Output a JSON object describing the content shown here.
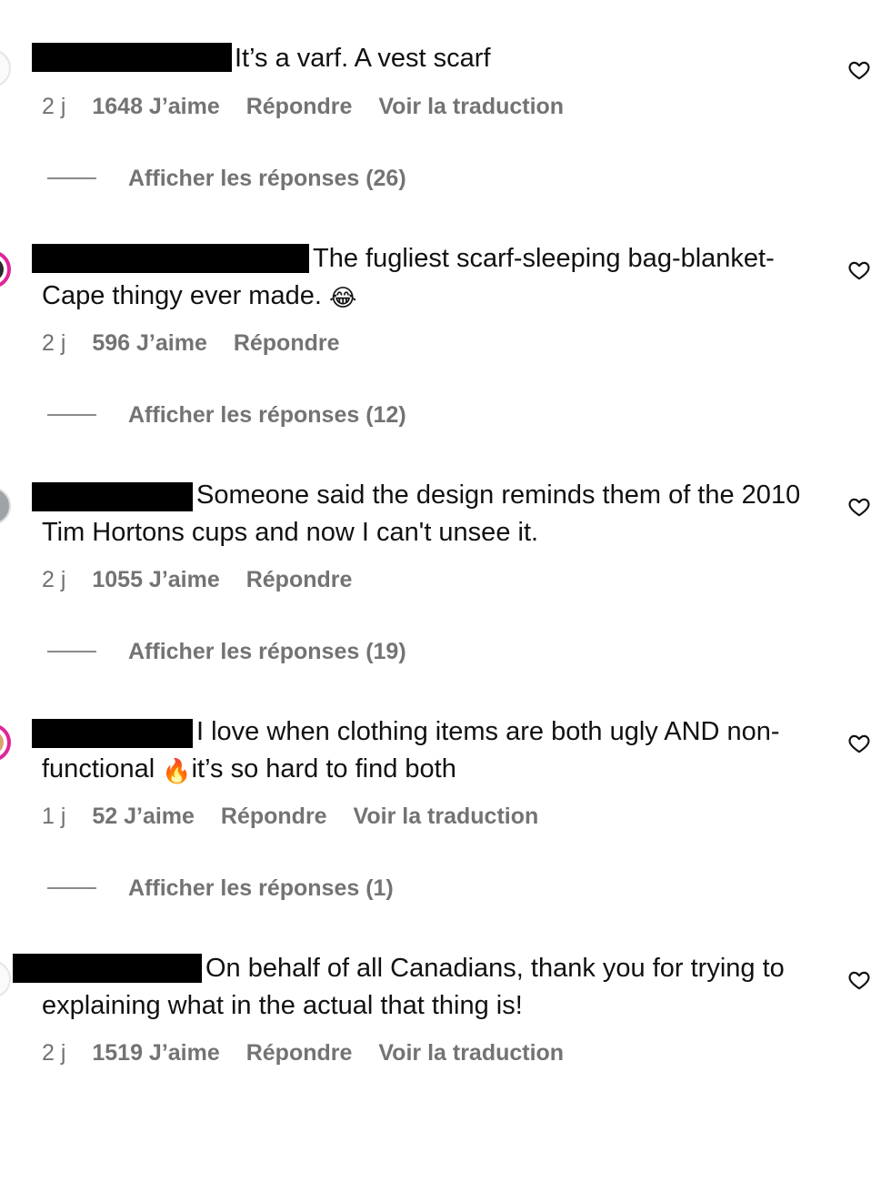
{
  "comments": [
    {
      "text": "It’s a varf. A vest scarf",
      "age": "2 j",
      "likes": "1648 J’aime",
      "reply_label": "Répondre",
      "translate_label": "Voir la traduction",
      "view_replies_label": "Afficher les réponses (26)"
    },
    {
      "text": "The fugliest scarf-sleeping bag-blanket-Cape thingy ever made.",
      "emoji": "😂",
      "age": "2 j",
      "likes": "596 J’aime",
      "reply_label": "Répondre",
      "view_replies_label": "Afficher les réponses (12)"
    },
    {
      "text": "Someone said the design reminds them of the 2010 Tim Hortons cups and now I can't unsee it.",
      "age": "2 j",
      "likes": "1055 J’aime",
      "reply_label": "Répondre",
      "view_replies_label": "Afficher les réponses (19)"
    },
    {
      "text_part1": "I love when clothing items are both ugly AND non-functional",
      "emoji": "🔥",
      "text_part2": "it’s so hard to find both",
      "age": "1 j",
      "likes": "52 J’aime",
      "reply_label": "Répondre",
      "translate_label": "Voir la traduction",
      "view_replies_label": "Afficher les réponses (1)"
    },
    {
      "text": "On behalf of all Canadians, thank you for trying to explaining what in the actual that thing is!",
      "age": "2 j",
      "likes": "1519 J’aime",
      "reply_label": "Répondre",
      "translate_label": "Voir la traduction"
    }
  ],
  "icons": {
    "like": "heart-outline-icon",
    "avatar": "profile-avatar"
  },
  "colors": {
    "meta_text": "#737373",
    "redaction": "#000000",
    "story_ring": "#e0259a"
  }
}
